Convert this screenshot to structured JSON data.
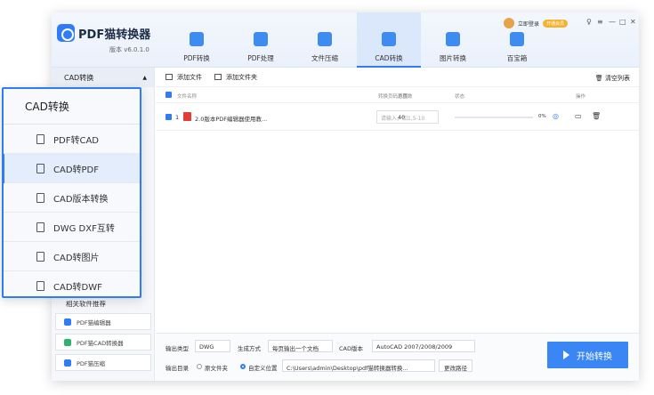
{
  "app": {
    "title": "PDF猫转换器",
    "version": "版本 v6.0.1.0"
  },
  "user": {
    "login": "立即登录",
    "vip": "开通会员"
  },
  "window": {
    "skin": "♀",
    "menu": "≡",
    "minimize": "—",
    "maximize": "□",
    "close": "✕"
  },
  "nav": [
    {
      "label": "PDF转换"
    },
    {
      "label": "PDF处理"
    },
    {
      "label": "文件压缩"
    },
    {
      "label": "CAD转换"
    },
    {
      "label": "图片转换"
    },
    {
      "label": "百宝箱"
    }
  ],
  "sidebar": {
    "header": "CAD转换",
    "related_title": "相关软件推荐",
    "related": [
      {
        "label": "PDF猫编辑器",
        "color": "#2f7cf6"
      },
      {
        "label": "PDF猫CAD转换器",
        "color": "#2db36a"
      },
      {
        "label": "PDF猫压缩",
        "color": "#2f7cf6"
      }
    ]
  },
  "popup": {
    "title": "CAD转换",
    "items": [
      {
        "label": "PDF转CAD"
      },
      {
        "label": "CAD转PDF"
      },
      {
        "label": "CAD版本转换"
      },
      {
        "label": "DWG DXF互转"
      },
      {
        "label": "CAD转图片"
      },
      {
        "label": "CAD转DWF"
      }
    ]
  },
  "toolbar": {
    "add_file": "添加文件",
    "add_folder": "添加文件夹",
    "clear": "清空列表"
  },
  "table": {
    "headers": {
      "name": "文件名称",
      "pages": "总页数",
      "range": "转换页码范围",
      "status": "状态",
      "action": "操作"
    },
    "rows": [
      {
        "index": "1",
        "name": "2.0版本PDF编辑器使用教...",
        "pages": "40",
        "range_placeholder": "请输入，如1,5-10",
        "progress": "0%"
      }
    ]
  },
  "bottom": {
    "output_type_label": "输出类型",
    "output_type": "DWG",
    "gen_label": "生成方式",
    "gen": "每页输出一个文档",
    "cad_label": "CAD版本",
    "cad": "AutoCAD 2007/2008/2009",
    "dir_label": "输出目录",
    "orig": "原文件夹",
    "custom": "自定义位置",
    "path": "C:\\Users\\admin\\Desktop\\pdf猫转换器转换...",
    "change": "更改路径",
    "start": "开始转换"
  }
}
